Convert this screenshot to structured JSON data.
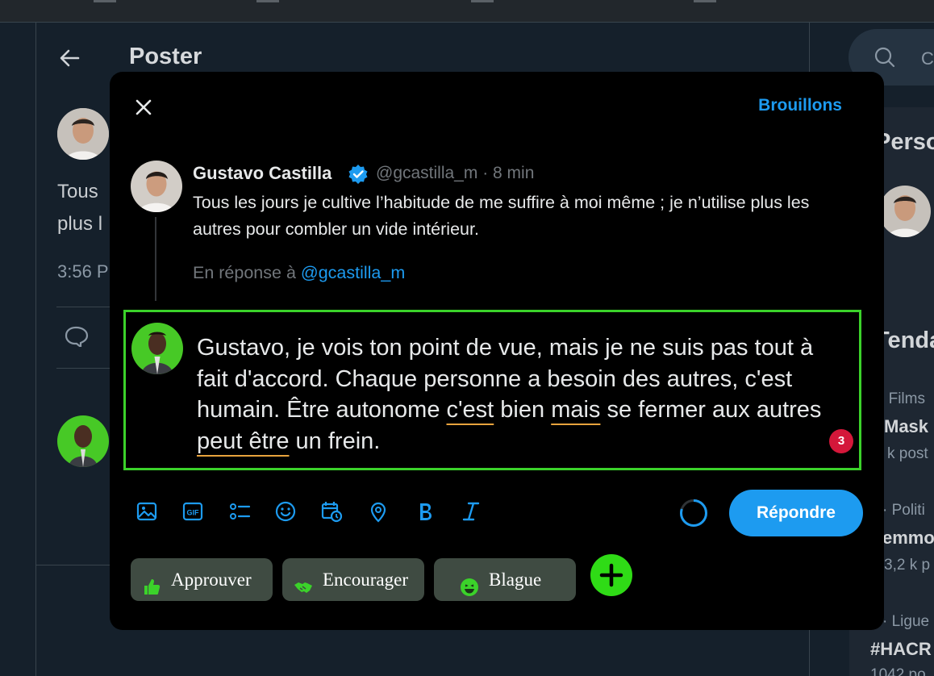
{
  "background": {
    "header_title": "Poster",
    "tweet_text_line1": "Tous",
    "tweet_text_line2": "plus l",
    "timestamp": "3:56 P",
    "search_placeholder": "C",
    "right_panel": {
      "section_title": "Perso",
      "trending_title": "Tenda",
      "trend_items": [
        {
          "category": "· Films",
          "name": "Mask",
          "posts": "k post"
        },
        {
          "category": "· Politi",
          "name": "emmo",
          "posts": "3,2 k p"
        },
        {
          "category": "· Ligue",
          "name": "#HACR",
          "posts": "1042 po"
        }
      ]
    }
  },
  "modal": {
    "drafts_label": "Brouillons",
    "original_tweet": {
      "author_name": "Gustavo Castilla",
      "handle_time": "@gcastilla_m · 8 min",
      "text": "Tous les jours je cultive l’habitude de me suffire à moi même ; je n’utilise plus les autres pour combler un vide intérieur.",
      "reply_prefix": "En réponse à",
      "reply_handle": "@gcastilla_m"
    },
    "compose": {
      "text_parts": [
        "Gustavo, je vois ton point de vue, mais je ne suis pas tout à fait d'accord. Chaque personne a besoin des autres, c'est humain. Être autonome ",
        "c'est",
        " bien ",
        "mais",
        " se fermer aux autres ",
        "peut être",
        " un frein."
      ],
      "issue_count": "3"
    },
    "toolbar": {
      "icons": [
        "image-icon",
        "gif-icon",
        "poll-icon",
        "emoji-icon",
        "schedule-icon",
        "location-icon",
        "bold-icon",
        "italic-icon"
      ],
      "reply_label": "Répondre"
    },
    "suggestion_chips": [
      {
        "label": "Approuver",
        "icon": "thumbs-up-icon"
      },
      {
        "label": "Encourager",
        "icon": "handshake-icon"
      },
      {
        "label": "Blague",
        "icon": "laughing-face-icon"
      }
    ]
  },
  "colors": {
    "accent": "#1d9bf0",
    "highlight_border": "#3bd22a",
    "chip_bg": "#3f4b42",
    "add_button": "#2fdb16",
    "spell_underline": "#e8a33d",
    "badge": "#d4173a"
  }
}
